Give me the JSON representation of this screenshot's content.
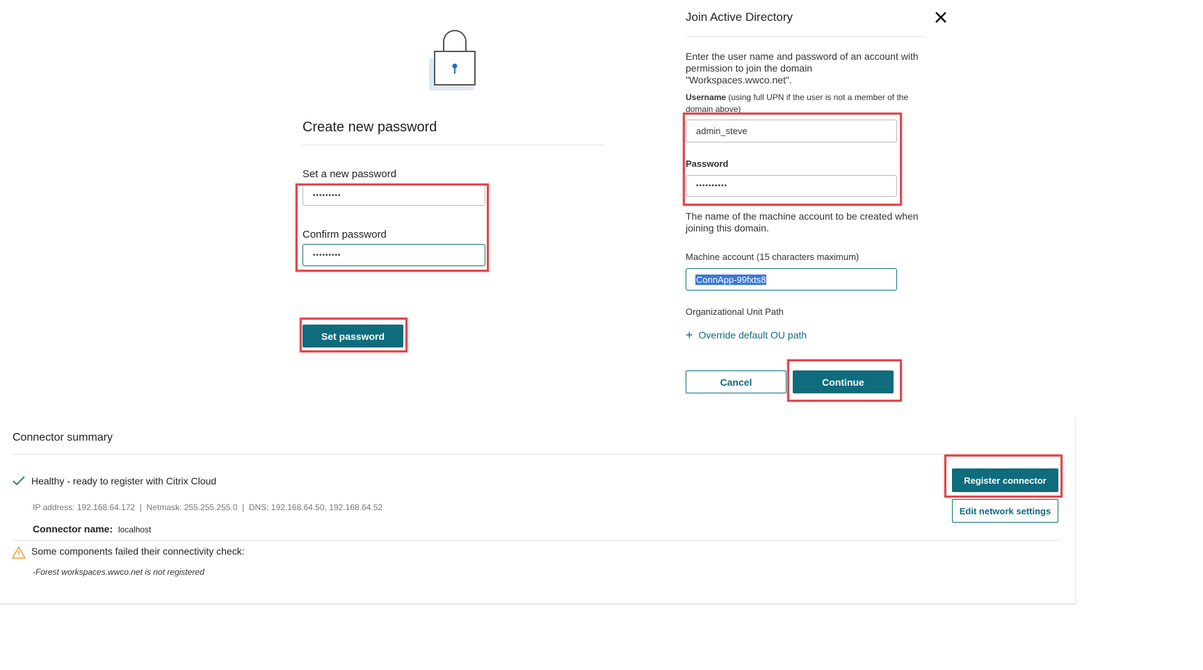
{
  "create_password": {
    "title": "Create new password",
    "new_password_label": "Set a new password",
    "new_password_value": "•••••••••",
    "confirm_password_label": "Confirm password",
    "confirm_password_value": "•••••••••",
    "set_password_button": "Set password"
  },
  "join_ad": {
    "title": "Join Active Directory",
    "description": "Enter the user name and password of an account with permission to join the domain \"Workspaces.wwco.net\".",
    "username_label": "Username",
    "username_hint": "(using full UPN if the user is not a member of the domain above)",
    "username_value": "admin_steve",
    "password_label": "Password",
    "password_value": "••••••••••",
    "machine_description": "The name of the machine account to be created when joining this domain.",
    "machine_label": "Machine account (15 characters maximum)",
    "machine_value": "ConnApp-99fxts8",
    "ou_label": "Organizational Unit Path",
    "ou_link": "Override default OU path",
    "cancel_button": "Cancel",
    "continue_button": "Continue"
  },
  "connector": {
    "title": "Connector summary",
    "status": "Healthy - ready to register with Citrix Cloud",
    "network_info": "IP address: 192.168.64.172  |  Netmask: 255.255.255.0  |  DNS: 192.168.64.50, 192.168.64.52",
    "name_label": "Connector name:",
    "name_value": "localhost",
    "warning": "Some components failed their connectivity check:",
    "warning_detail": "-Forest workspaces.wwco.net is not registered",
    "register_button": "Register connector",
    "edit_button": "Edit network settings"
  },
  "colors": {
    "accent": "#0e6c7d",
    "highlight": "#e0474c",
    "success": "#2e8b57",
    "warning": "#e6a23c"
  }
}
